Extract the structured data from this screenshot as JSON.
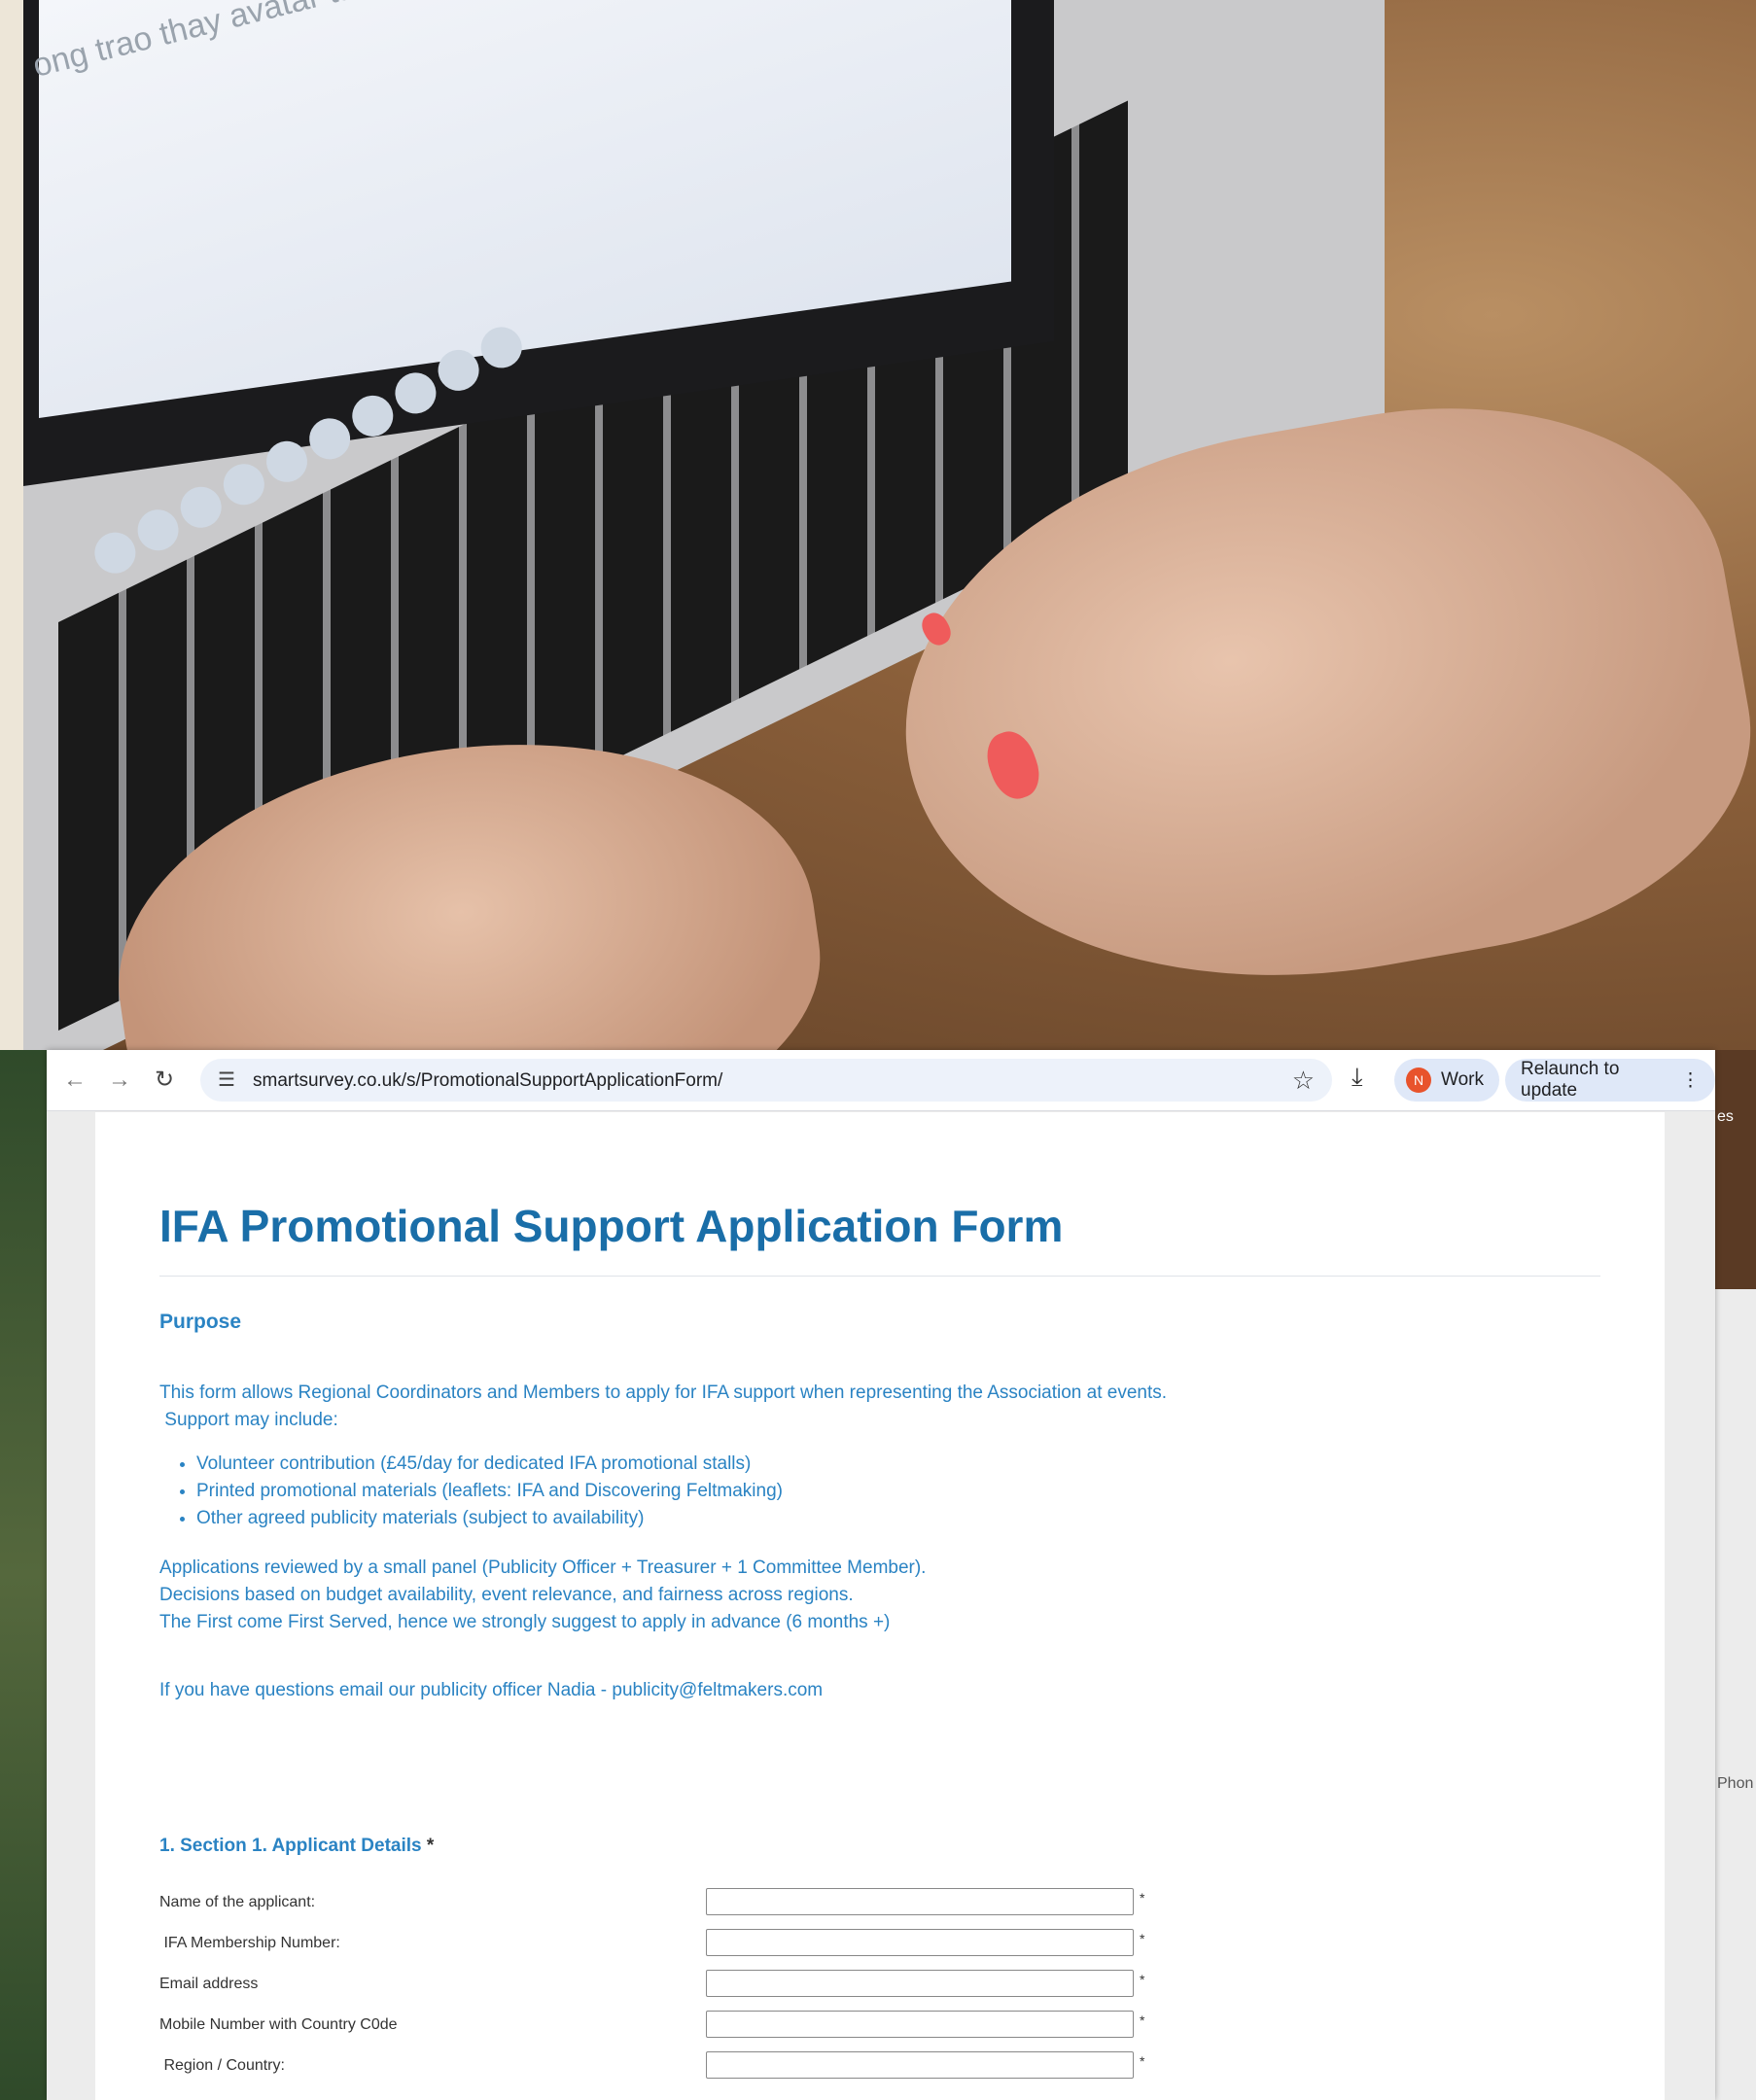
{
  "browser": {
    "url": "smartsurvey.co.uk/s/PromotionalSupportApplicationForm/",
    "profile_initial": "N",
    "profile_label": "Work",
    "relaunch_label": "Relaunch to update"
  },
  "background": {
    "laptop_screen_text": "ong trao thay avatar tàu...",
    "right_edge_text": "es",
    "right_phone_text": "Phon"
  },
  "form": {
    "title": "IFA Promotional Support Application Form",
    "purpose_heading": "Purpose",
    "intro_line1": "This form allows Regional Coordinators and Members to apply for IFA support when representing the Association at events.",
    "intro_line2": " Support may include:",
    "bullets": [
      "Volunteer contribution (£45/day for dedicated IFA promotional stalls)",
      "Printed promotional materials (leaflets: IFA and Discovering Feltmaking)",
      "Other agreed publicity materials (subject to availability)"
    ],
    "review_line1": "Applications reviewed by a small panel (Publicity Officer + Treasurer + 1 Committee Member).",
    "review_line2": "Decisions based on budget availability, event relevance, and fairness across regions.",
    "review_line3": "The First come First Served, hence we strongly suggest to apply in advance (6 months +)",
    "contact_line": "If you have questions email our publicity officer Nadia - publicity@feltmakers.com",
    "section1_title": "1. Section 1. Applicant Details",
    "required_mark": "*",
    "fields": [
      {
        "label": "Name of the applicant:",
        "value": ""
      },
      {
        "label": " IFA Membership Number:",
        "value": ""
      },
      {
        "label": "Email address",
        "value": ""
      },
      {
        "label": "Mobile Number with Country C0de",
        "value": ""
      },
      {
        "label": " Region / Country:",
        "value": ""
      }
    ]
  }
}
